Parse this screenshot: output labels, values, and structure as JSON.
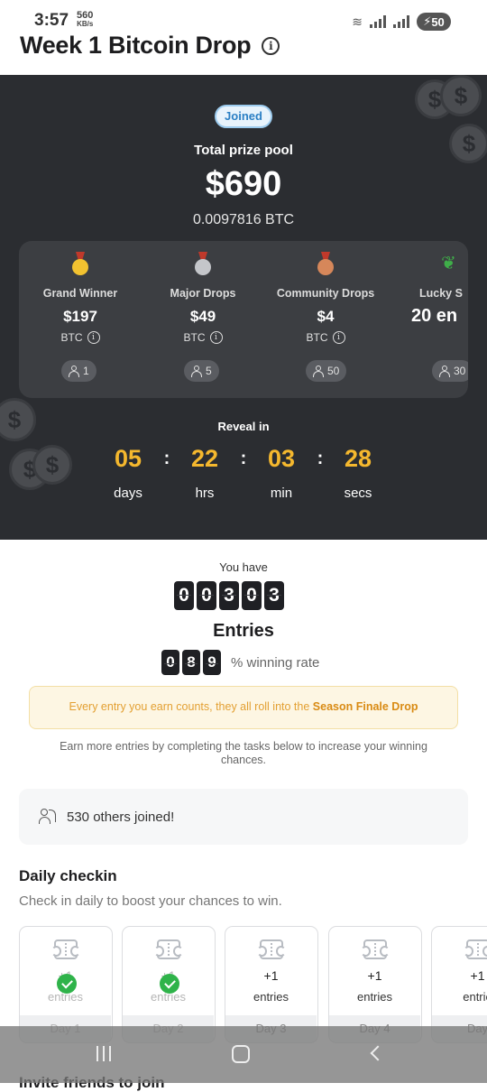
{
  "status": {
    "time": "3:57",
    "speed_value": "560",
    "speed_unit": "KB/s",
    "battery": "50"
  },
  "header": {
    "title": "Week 1 Bitcoin Drop",
    "info_icon": "info-icon"
  },
  "hero": {
    "badge": "Joined",
    "pool_label": "Total prize pool",
    "pool_amount": "$690",
    "pool_btc": "0.0097816 BTC",
    "tiers": [
      {
        "name": "Grand Winner",
        "value": "$197",
        "unit": "BTC",
        "count": "1",
        "icon": "gold-medal-icon"
      },
      {
        "name": "Major Drops",
        "value": "$49",
        "unit": "BTC",
        "count": "5",
        "icon": "silver-medal-icon"
      },
      {
        "name": "Community Drops",
        "value": "$4",
        "unit": "BTC",
        "count": "50",
        "icon": "bronze-medal-icon"
      },
      {
        "name": "Lucky S",
        "value": "20 en",
        "unit": "",
        "count": "30",
        "icon": "sprout-icon"
      }
    ],
    "reveal_label": "Reveal in",
    "countdown": [
      {
        "value": "05",
        "unit": "days"
      },
      {
        "value": "22",
        "unit": "hrs"
      },
      {
        "value": "03",
        "unit": "min"
      },
      {
        "value": "28",
        "unit": "secs"
      }
    ]
  },
  "entries": {
    "you_have": "You have",
    "digits": [
      "0",
      "0",
      "3",
      "0",
      "3"
    ],
    "label": "Entries",
    "rate_digits": [
      "0",
      "8",
      "9"
    ],
    "rate_suffix": "% winning rate"
  },
  "notice": {
    "text": "Every entry you earn counts, they all roll into the ",
    "highlight": "Season Finale Drop"
  },
  "earn_text": "Earn more entries by completing the tasks below to increase your winning chances.",
  "joined_card": {
    "text": "530 others joined!"
  },
  "checkin": {
    "title": "Daily checkin",
    "subtitle": "Check in daily to boost your chances to win.",
    "days": [
      {
        "plus": "+1",
        "entries": "entries",
        "label": "Day 1",
        "done": true
      },
      {
        "plus": "+1",
        "entries": "entries",
        "label": "Day 2",
        "done": true
      },
      {
        "plus": "+1",
        "entries": "entries",
        "label": "Day 3",
        "done": false
      },
      {
        "plus": "+1",
        "entries": "entries",
        "label": "Day 4",
        "done": false
      },
      {
        "plus": "+1",
        "entries": "entrie",
        "label": "Day",
        "done": false
      }
    ]
  },
  "invite": {
    "title": "Invite friends to join"
  },
  "colors": {
    "hero_bg": "#2b2d31",
    "countdown": "#f5b82e",
    "accent_blue": "#2b7fc4",
    "notice": "#e3a033",
    "check_green": "#2fb34a"
  }
}
